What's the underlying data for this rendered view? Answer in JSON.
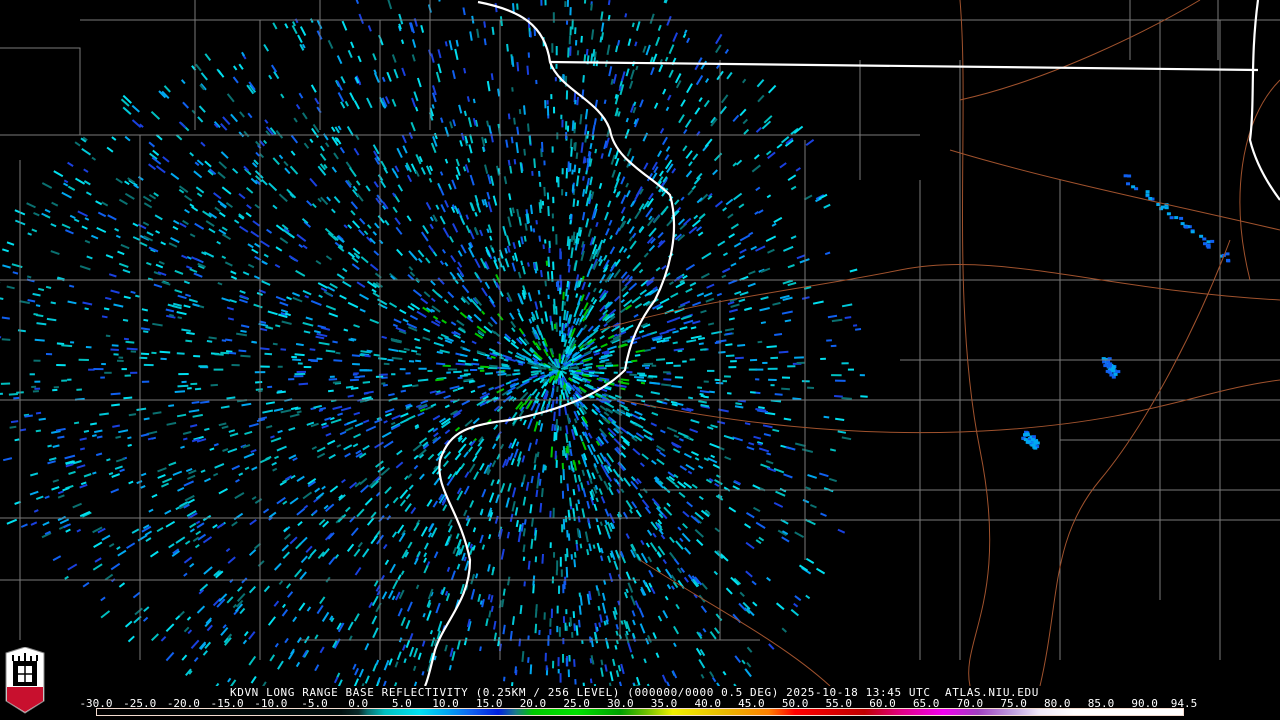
{
  "product_title": "KDVN LONG RANGE BASE REFLECTIVITY (0.25KM / 256 LEVEL) (000000/0000 0.5 DEG) 2025-10-18 13:45 UTC  ATLAS.NIU.EDU",
  "logo_text": "NIU",
  "legend": {
    "ticks": [
      "-30.0",
      "-25.0",
      "-20.0",
      "-15.0",
      "-10.0",
      "-5.0",
      "0.0",
      "5.0",
      "10.0",
      "15.0",
      "20.0",
      "25.0",
      "30.0",
      "35.0",
      "40.0",
      "45.0",
      "50.0",
      "55.0",
      "60.0",
      "65.0",
      "70.0",
      "75.0",
      "80.0",
      "85.0",
      "90.0",
      "94.5"
    ],
    "range": [
      -30,
      94.5
    ],
    "colors": [
      {
        "v": -30,
        "c": "#000000"
      },
      {
        "v": -2,
        "c": "#001010"
      },
      {
        "v": 0,
        "c": "#0a2a2a"
      },
      {
        "v": 1,
        "c": "#0a7070"
      },
      {
        "v": 3,
        "c": "#00c0c0"
      },
      {
        "v": 7,
        "c": "#00e0f0"
      },
      {
        "v": 10,
        "c": "#00a8f0"
      },
      {
        "v": 13,
        "c": "#1060f0"
      },
      {
        "v": 16,
        "c": "#0020e0"
      },
      {
        "v": 18,
        "c": "#1a7a8a"
      },
      {
        "v": 20,
        "c": "#00c800"
      },
      {
        "v": 25,
        "c": "#00e000"
      },
      {
        "v": 30,
        "c": "#00a000"
      },
      {
        "v": 33,
        "c": "#70c000"
      },
      {
        "v": 36,
        "c": "#f0f000"
      },
      {
        "v": 42,
        "c": "#e8b800"
      },
      {
        "v": 47,
        "c": "#ff8000"
      },
      {
        "v": 50,
        "c": "#ff0000"
      },
      {
        "v": 58,
        "c": "#c00000"
      },
      {
        "v": 62,
        "c": "#e00080"
      },
      {
        "v": 67,
        "c": "#f000f0"
      },
      {
        "v": 71,
        "c": "#a040c0"
      },
      {
        "v": 75,
        "c": "#c0a0e0"
      },
      {
        "v": 78,
        "c": "#f0e8f8"
      },
      {
        "v": 82,
        "c": "#ffffff"
      },
      {
        "v": 94.5,
        "c": "#ffffff"
      }
    ]
  },
  "colors": {
    "state_line": "#ffffff",
    "county_line": "#808080",
    "road": "#a0522d"
  }
}
